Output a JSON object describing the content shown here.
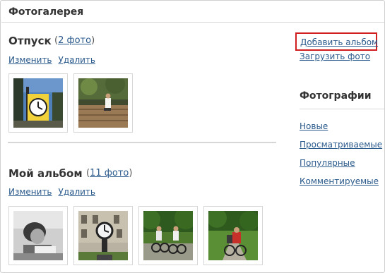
{
  "header": {
    "title": "Фотогалерея"
  },
  "albums": [
    {
      "title": "Отпуск",
      "count_open": "(",
      "count_link": "2 фото",
      "count_close": ")",
      "edit_label": "Изменить",
      "delete_label": "Удалить",
      "photos": [
        "clock-tower-photo",
        "stairs-photo"
      ]
    },
    {
      "title": "Мой альбом",
      "count_open": "(",
      "count_link": "11 фото",
      "count_close": ")",
      "edit_label": "Изменить",
      "delete_label": "Удалить",
      "photos": [
        "girl-reading-photo",
        "clock-building-photo",
        "cyclists-photo",
        "cyclist-park-photo"
      ]
    }
  ],
  "sidebar": {
    "add_album_label": "Добавить альбом",
    "upload_label": "Загрузить фото",
    "photos_heading": "Фотографии",
    "links": [
      "Новые",
      "Просматриваемые",
      "Популярные",
      "Комментируемые"
    ]
  },
  "colors": {
    "link": "#2b5a8c",
    "highlight_border": "#d11e1e",
    "text": "#333333"
  }
}
